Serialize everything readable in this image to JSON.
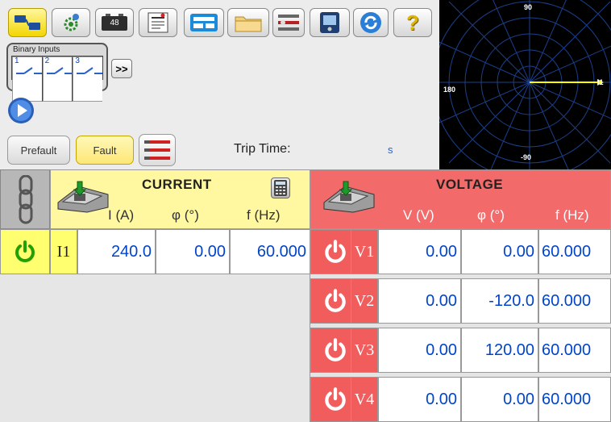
{
  "toolbar": {
    "icons": [
      "network-config-icon",
      "settings-icon",
      "battery-icon",
      "test-report-icon",
      "test-card-icon",
      "folder-icon",
      "sequence-icon",
      "device-icon",
      "refresh-icon",
      "help-icon"
    ],
    "battery_label": "48",
    "help_label": "?"
  },
  "binary_inputs": {
    "title": "Binary Inputs",
    "inputs": [
      "1",
      "2",
      "3"
    ],
    "expand_label": ">>"
  },
  "controls": {
    "prefault_label": "Prefault",
    "fault_label": "Fault",
    "trip_time_label": "Trip Time:",
    "trip_time_value": "",
    "trip_time_unit": "s"
  },
  "polar": {
    "label_top": "90",
    "label_left": "180",
    "label_bottom": "-90",
    "phasor_label": "I1",
    "phasor_color": "#ffff00",
    "phasor_angle_deg": 0
  },
  "current": {
    "title": "CURRENT",
    "columns": [
      "I (A)",
      "φ (°)",
      "f (Hz)"
    ],
    "rows": [
      {
        "label": "I1",
        "amplitude": "240.0",
        "phase": "0.00",
        "freq": "60.000"
      }
    ]
  },
  "voltage": {
    "title": "VOLTAGE",
    "columns": [
      "V (V)",
      "φ (°)",
      "f (Hz)"
    ],
    "rows": [
      {
        "label": "V1",
        "amplitude": "0.00",
        "phase": "0.00",
        "freq": "60.000"
      },
      {
        "label": "V2",
        "amplitude": "0.00",
        "phase": "-120.0",
        "freq": "60.000"
      },
      {
        "label": "V3",
        "amplitude": "0.00",
        "phase": "120.00",
        "freq": "60.000"
      },
      {
        "label": "V4",
        "amplitude": "0.00",
        "phase": "0.00",
        "freq": "60.000"
      }
    ]
  },
  "colors": {
    "current_header": "#fff8a0",
    "voltage_header": "#f26a6a",
    "value_text": "#0044cc",
    "power_icon_green": "#22a000",
    "power_icon_red": "#ffffff"
  }
}
